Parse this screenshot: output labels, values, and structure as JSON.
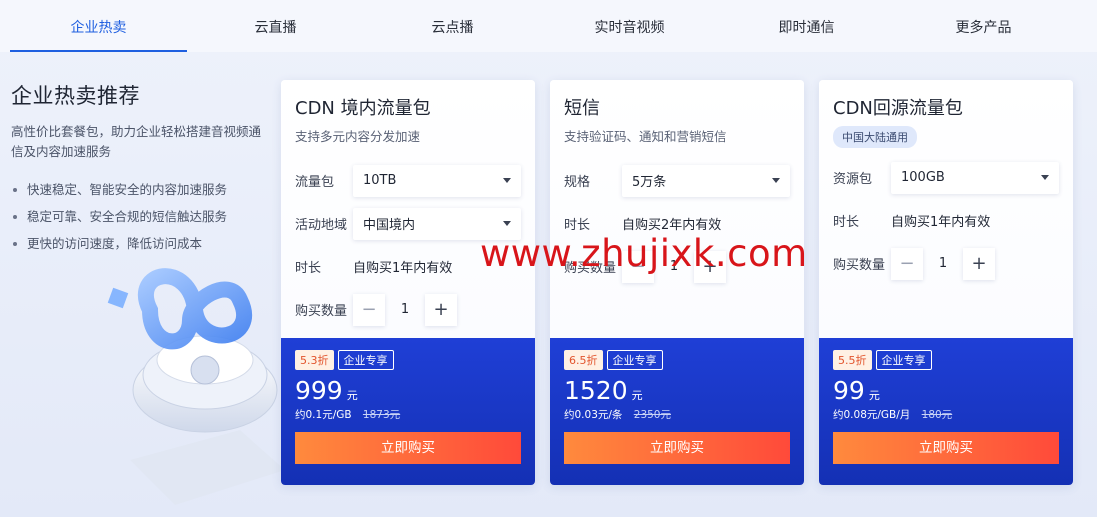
{
  "tabs": [
    "企业热卖",
    "云直播",
    "云点播",
    "实时音视频",
    "即时通信",
    "更多产品"
  ],
  "intro": {
    "title": "企业热卖推荐",
    "desc": "高性价比套餐包，助力企业轻松搭建音视频通信及内容加速服务",
    "bullets": [
      "快速稳定、智能安全的内容加速服务",
      "稳定可靠、安全合规的短信触达服务",
      "更快的访问速度，降低访问成本"
    ]
  },
  "cards": [
    {
      "title": "CDN 境内流量包",
      "subtitle": "支持多元内容分发加速",
      "fields": {
        "f1_label": "流量包",
        "f1_value": "10TB",
        "f2_label": "活动地域",
        "f2_value": "中国境内",
        "f3_label": "时长",
        "f3_value": "自购买1年内有效",
        "qty_label": "购买数量",
        "qty": "1"
      },
      "discount": "5.3折",
      "ent_tag": "企业专享",
      "price": "999",
      "price_unit": "元",
      "unit_price": "约0.1元/GB",
      "orig_price": "1873元",
      "buy": "立即购买"
    },
    {
      "title": "短信",
      "subtitle": "支持验证码、通知和营销短信",
      "fields": {
        "f1_label": "规格",
        "f1_value": "5万条",
        "f3_label": "时长",
        "f3_value": "自购买2年内有效",
        "qty_label": "购买数量",
        "qty": "1"
      },
      "discount": "6.5折",
      "ent_tag": "企业专享",
      "price": "1520",
      "price_unit": "元",
      "unit_price": "约0.03元/条",
      "orig_price": "2350元",
      "buy": "立即购买"
    },
    {
      "title": "CDN回源流量包",
      "badge": "中国大陆通用",
      "fields": {
        "f1_label": "资源包",
        "f1_value": "100GB",
        "f3_label": "时长",
        "f3_value": "自购买1年内有效",
        "qty_label": "购买数量",
        "qty": "1"
      },
      "discount": "5.5折",
      "ent_tag": "企业专享",
      "price": "99",
      "price_unit": "元",
      "unit_price": "约0.08元/GB/月",
      "orig_price": "180元",
      "buy": "立即购买"
    }
  ],
  "watermark": "www.zhujixk.com",
  "colors": {
    "accent": "#1f5fe0",
    "card_bottom": "#1f3fd6",
    "buy_button_start": "#ff8a3d",
    "buy_button_end": "#ff4a3a"
  }
}
